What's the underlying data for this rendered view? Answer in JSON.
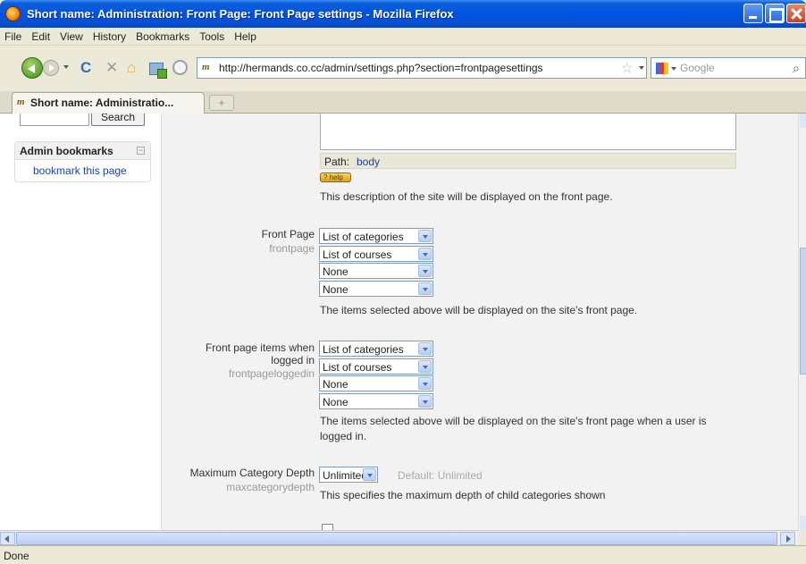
{
  "window": {
    "title": "Short name: Administration: Front Page: Front Page settings - Mozilla Firefox"
  },
  "menu": [
    "File",
    "Edit",
    "View",
    "History",
    "Bookmarks",
    "Tools",
    "Help"
  ],
  "nav": {
    "url": "http://hermands.co.cc/admin/settings.php?section=frontpagesettings",
    "search_placeholder": "Google"
  },
  "tab": {
    "label": "Short name: Administratio...",
    "new_tab": "+"
  },
  "sidebar": {
    "search_button": "Search",
    "admin_bookmarks_title": "Admin bookmarks",
    "collapse_symbol": "−",
    "bookmark_link": "bookmark this page"
  },
  "main": {
    "path_label": "Path:",
    "path_value": "body",
    "help_badge": "? help",
    "summary_desc": "This description of the site will be displayed on the front page.",
    "front_page": {
      "label": "Front Page",
      "sub": "frontpage",
      "selects": [
        "List of categories",
        "List of courses",
        "None",
        "None"
      ],
      "desc": "The items selected above will be displayed on the site's front page."
    },
    "front_page_loggedin": {
      "label_line1": "Front page items when",
      "label_line2": "logged in",
      "sub": "frontpageloggedin",
      "selects": [
        "List of categories",
        "List of courses",
        "None",
        "None"
      ],
      "desc_line1": "The items selected above will be displayed on the site's front page when a user is",
      "desc_line2": "logged in."
    },
    "max_category_depth": {
      "label": "Maximum Category Depth",
      "sub": "maxcategorydepth",
      "value": "Unlimited",
      "default": "Default: Unlimited",
      "desc": "This specifies the maximum depth of child categories shown"
    }
  },
  "status": {
    "text": "Done"
  }
}
